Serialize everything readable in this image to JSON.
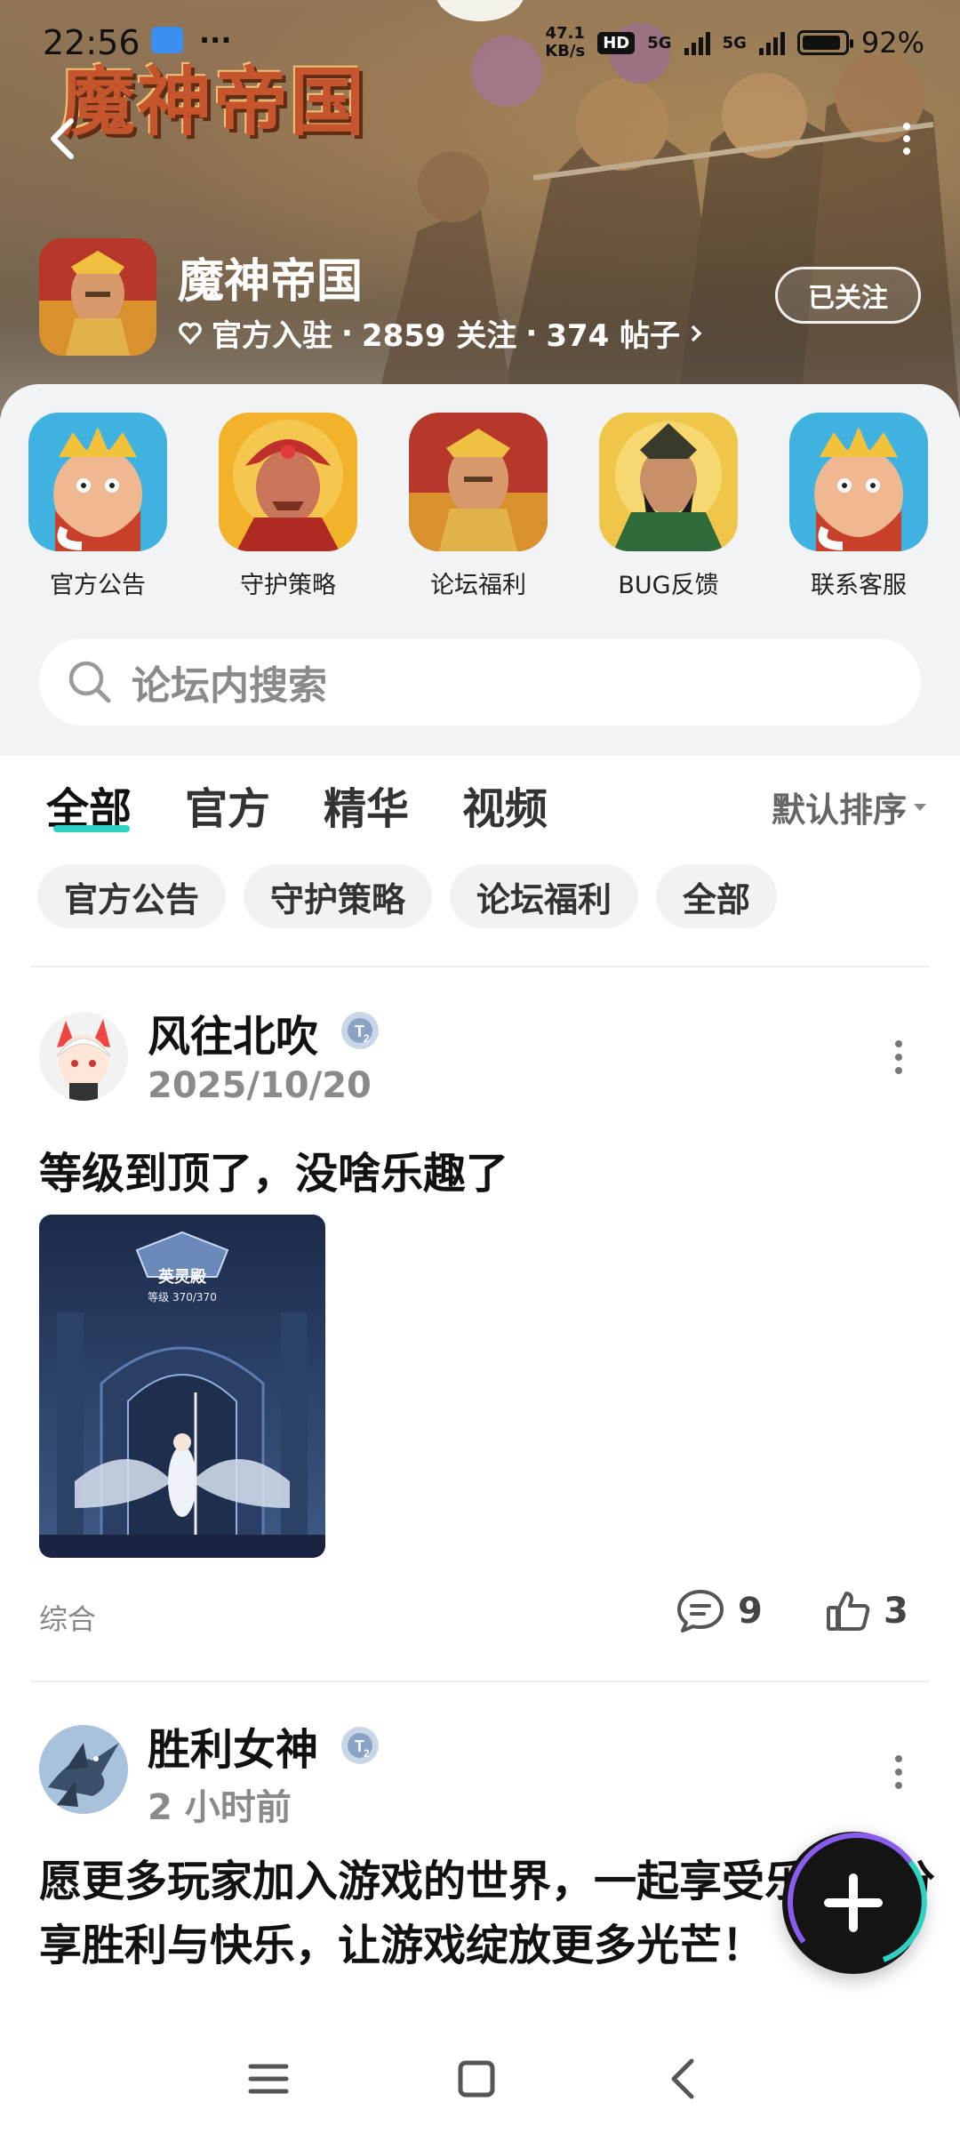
{
  "status_bar": {
    "time": "22:56",
    "more": "···",
    "speed_top": "47.1",
    "speed_bottom": "KB/s",
    "hd": "HD",
    "net1": "5G",
    "net2": "5G",
    "battery_pct": "92%",
    "battery_level": 0.92
  },
  "header": {
    "logo_text": "魔神帝国",
    "back_icon": "chevron-left-icon",
    "more_icon": "more-vertical-icon"
  },
  "forum": {
    "name": "魔神帝国",
    "official": "官方入驻",
    "followers": "2859 关注",
    "posts": "374 帖子",
    "sep": "·",
    "follow_label": "已关注"
  },
  "shortcuts": [
    {
      "label": "官方公告",
      "icon": "king-avatar-icon"
    },
    {
      "label": "守护策略",
      "icon": "warrior-avatar-icon"
    },
    {
      "label": "论坛福利",
      "icon": "hero-avatar-icon"
    },
    {
      "label": "BUG反馈",
      "icon": "general-avatar-icon"
    },
    {
      "label": "联系客服",
      "icon": "king-avatar-icon"
    }
  ],
  "search": {
    "placeholder": "论坛内搜索",
    "icon": "search-icon"
  },
  "tabs": [
    {
      "label": "全部",
      "active": true
    },
    {
      "label": "官方",
      "active": false
    },
    {
      "label": "精华",
      "active": false
    },
    {
      "label": "视频",
      "active": false
    }
  ],
  "sort_label": "默认排序",
  "chips": [
    "官方公告",
    "守护策略",
    "论坛福利",
    "全部"
  ],
  "posts": [
    {
      "author": "风往北吹",
      "time": "2025/10/20",
      "title": "等级到顶了，没啥乐趣了",
      "image_title": "英灵殿",
      "image_level": "等级 370/370",
      "category": "综合",
      "comments": "9",
      "likes": "3"
    },
    {
      "author": "胜利女神",
      "time": "2 小时前",
      "body": "愿更多玩家加入游戏的世界，一起享受乐趣，分享胜利与快乐，让游戏绽放更多光芒！"
    }
  ],
  "colors": {
    "accent": "#2fd1c3",
    "text": "#111111",
    "muted": "#8a8a8a"
  },
  "nav": [
    "menu-icon",
    "home-square-icon",
    "back-triangle-icon"
  ]
}
